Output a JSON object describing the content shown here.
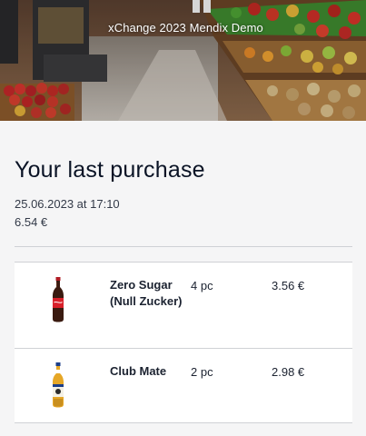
{
  "header": {
    "banner_title": "xChange 2023 Mendix Demo",
    "banner_image": "supermarket-produce-aisle"
  },
  "purchase": {
    "heading": "Your last purchase",
    "datetime": "25.06.2023 at 17:10",
    "total": "6.54 €"
  },
  "items": [
    {
      "name": "Zero Sugar (Null Zucker)",
      "quantity": "4 pc",
      "price": "3.56 €",
      "icon": "cola-bottle-icon"
    },
    {
      "name": "Club Mate",
      "quantity": "2 pc",
      "price": "2.98 €",
      "icon": "mate-bottle-icon"
    }
  ],
  "colors": {
    "text": "#0a1325",
    "background": "#f5f5f6",
    "divider": "#cfd1d5",
    "card": "#ffffff"
  }
}
